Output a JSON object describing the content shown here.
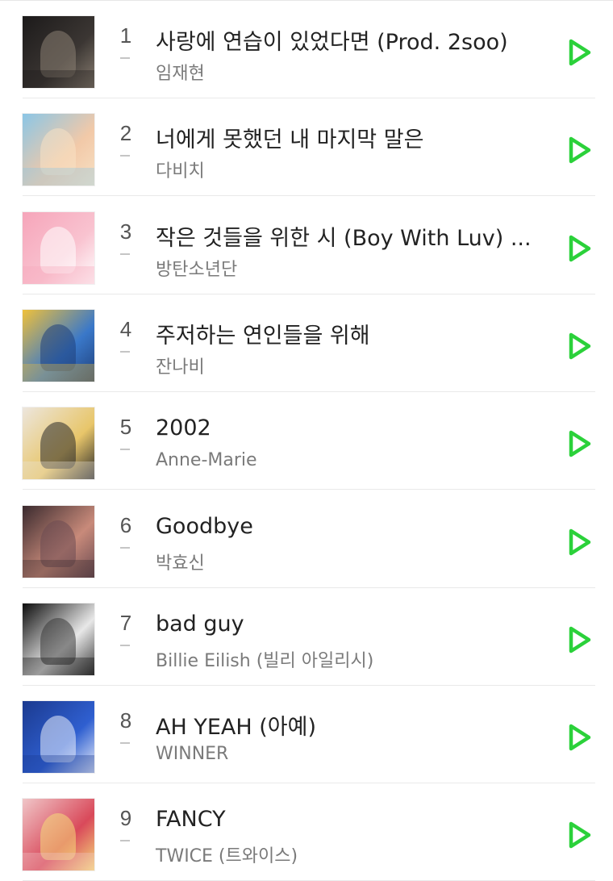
{
  "chart": {
    "accent": "#2bd13a",
    "songs": [
      {
        "rank": "1",
        "trend": "-",
        "title": "사랑에 연습이 있었다면 (Prod. 2soo)",
        "artist": "임재현",
        "cover": [
          "#1c1a1a",
          "#3b3633",
          "#8a7f72"
        ]
      },
      {
        "rank": "2",
        "trend": "-",
        "title": "너에게 못했던 내 마지막 말은",
        "artist": "다비치",
        "cover": [
          "#8ac6e6",
          "#f2c9a8",
          "#f7e1c4"
        ]
      },
      {
        "rank": "3",
        "trend": "-",
        "title": "작은 것들을 위한 시 (Boy With Luv) ...",
        "artist": "방탄소년단",
        "cover": [
          "#f6a5ba",
          "#f9c3d0",
          "#ffffff"
        ]
      },
      {
        "rank": "4",
        "trend": "-",
        "title": "주저하는 연인들을 위해",
        "artist": "잔나비",
        "cover": [
          "#f0c13a",
          "#3a78c9",
          "#1f3f7a"
        ]
      },
      {
        "rank": "5",
        "trend": "-",
        "title": "2002",
        "artist": "Anne-Marie",
        "cover": [
          "#ece6de",
          "#e8c66a",
          "#2a2a2a"
        ]
      },
      {
        "rank": "6",
        "trend": "-",
        "title": "Goodbye",
        "artist": "박효신",
        "cover": [
          "#3a2a2e",
          "#c88a7a",
          "#6b4b52"
        ]
      },
      {
        "rank": "7",
        "trend": "-",
        "title": "bad guy",
        "artist": "Billie Eilish (빌리 아일리시)",
        "cover": [
          "#0d0d0d",
          "#e8e8e8",
          "#3a3a3a"
        ]
      },
      {
        "rank": "8",
        "trend": "-",
        "title": "AH YEAH (아예)",
        "artist": "WINNER",
        "cover": [
          "#1b3a8f",
          "#2f5fd0",
          "#e9eefb"
        ]
      },
      {
        "rank": "9",
        "trend": "-",
        "title": "FANCY",
        "artist": "TWICE (트와이스)",
        "cover": [
          "#f0c6c8",
          "#d9495a",
          "#f5dc7a"
        ]
      }
    ]
  }
}
